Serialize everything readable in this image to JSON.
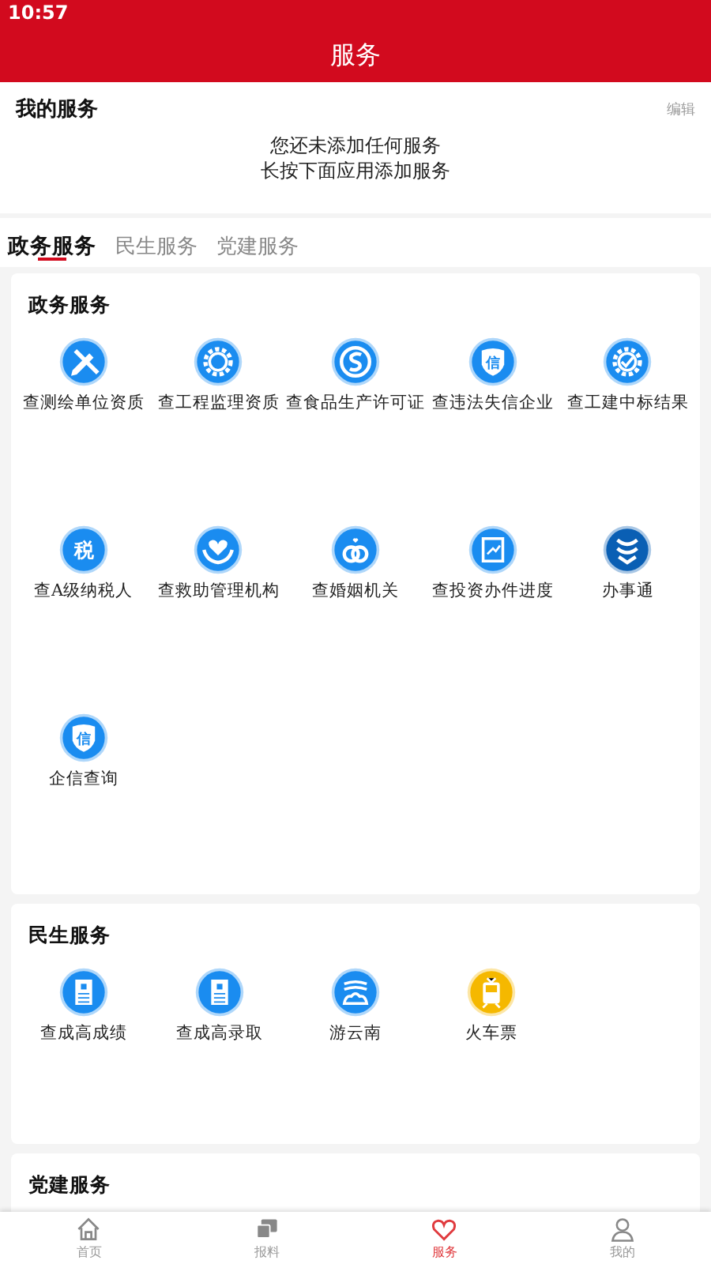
{
  "status_bar": {
    "time": "10:57"
  },
  "header": {
    "title": "服务"
  },
  "my_services": {
    "title": "我的服务",
    "edit": "编辑",
    "empty_lines": [
      "您还未添加任何服务",
      "长按下面应用添加服务"
    ]
  },
  "tabs": [
    {
      "label": "政务服务",
      "selected": true
    },
    {
      "label": "民生服务",
      "selected": false
    },
    {
      "label": "党建服务",
      "selected": false
    }
  ],
  "sections": [
    {
      "title": "政务服务",
      "items": [
        {
          "label": "查测绘单位资质",
          "kind": "pencil",
          "color": "#1a8cf0"
        },
        {
          "label": "查工程监理资质",
          "kind": "gear",
          "color": "#1a8cf0"
        },
        {
          "label": "查食品生产许可证",
          "kind": "s-mark",
          "color": "#1a8cf0"
        },
        {
          "label": "查违法失信企业",
          "kind": "shield",
          "glyph": "信",
          "color": "#1a8cf0"
        },
        {
          "label": "查工建中标结果",
          "kind": "gear-check",
          "color": "#1a8cf0"
        },
        {
          "label": "查A级纳税人",
          "kind": "glyph",
          "glyph": "税",
          "color": "#1a8cf0"
        },
        {
          "label": "查救助管理机构",
          "kind": "heart-hands",
          "color": "#1a8cf0"
        },
        {
          "label": "查婚姻机关",
          "kind": "rings",
          "color": "#1a8cf0"
        },
        {
          "label": "查投资办件进度",
          "kind": "chart-doc",
          "color": "#1a8cf0"
        },
        {
          "label": "办事通",
          "kind": "wave",
          "color": "#0a5fb4"
        },
        {
          "label": "企信查询",
          "kind": "shield",
          "glyph": "信",
          "color": "#1a8cf0"
        }
      ]
    },
    {
      "title": "民生服务",
      "items": [
        {
          "label": "查成高成绩",
          "kind": "doc",
          "color": "#1a8cf0"
        },
        {
          "label": "查成高录取",
          "kind": "doc",
          "color": "#1a8cf0"
        },
        {
          "label": "游云南",
          "kind": "cloud",
          "color": "#1a8cf0"
        },
        {
          "label": "火车票",
          "kind": "train",
          "color": "#f5b800"
        }
      ]
    },
    {
      "title": "党建服务"
    }
  ],
  "bottom_nav": [
    {
      "label": "首页",
      "kind": "home",
      "selected": false
    },
    {
      "label": "报料",
      "kind": "chat",
      "selected": false
    },
    {
      "label": "服务",
      "kind": "heart",
      "selected": true
    },
    {
      "label": "我的",
      "kind": "person",
      "selected": false
    }
  ]
}
